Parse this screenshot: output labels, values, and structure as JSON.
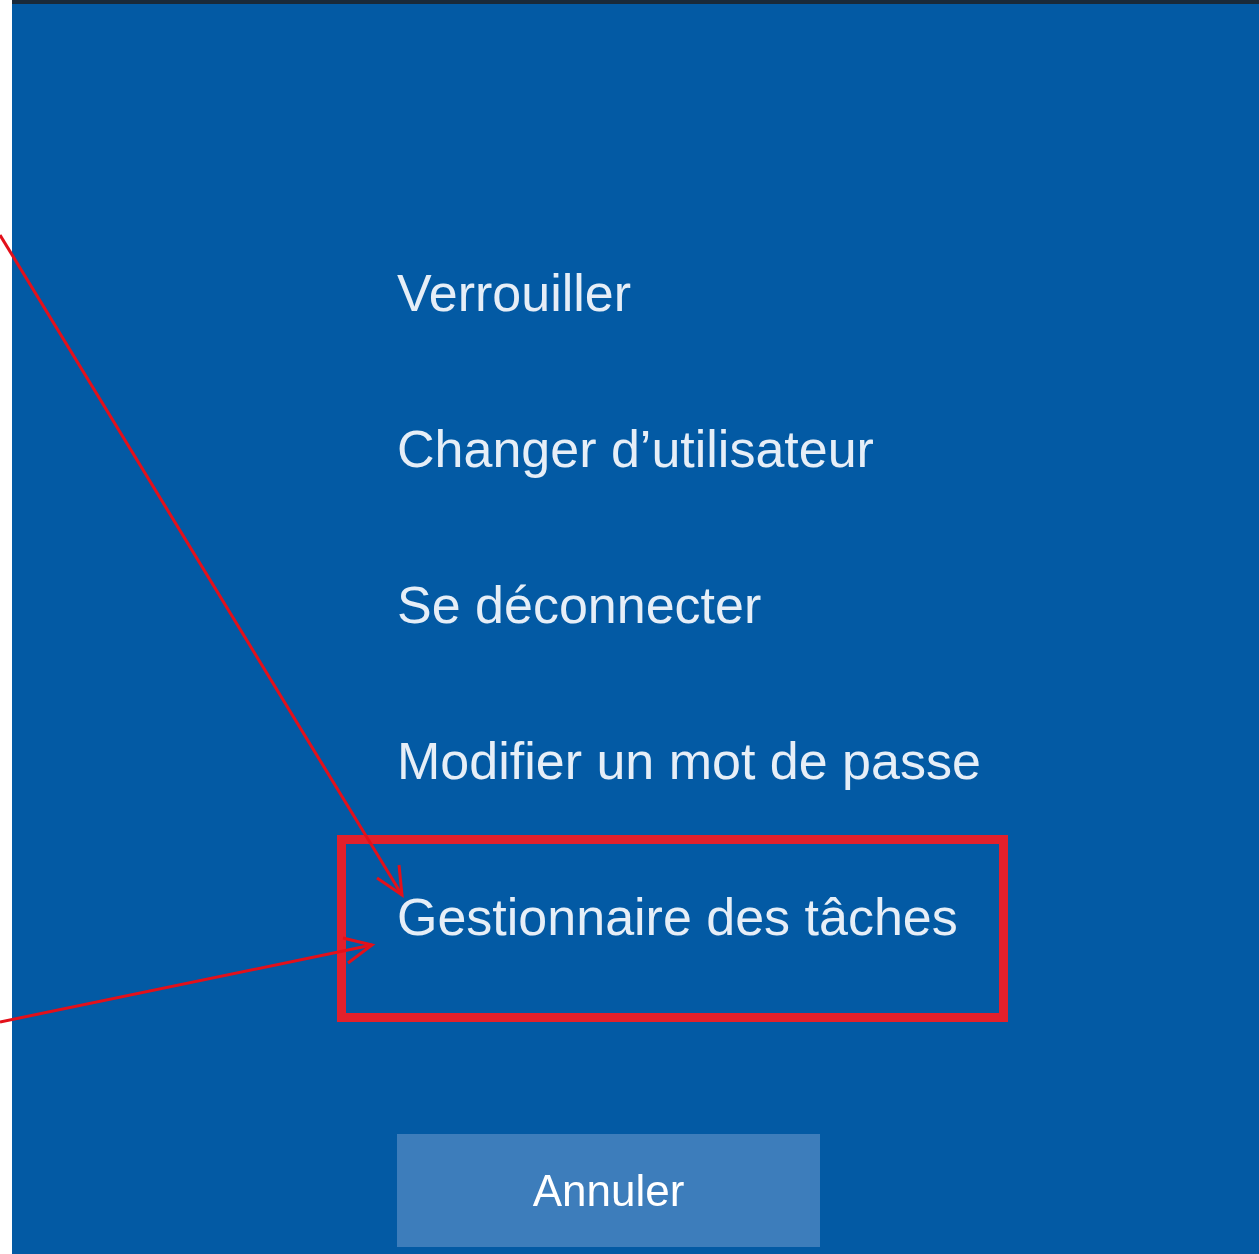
{
  "menu": [
    {
      "label": "Verrouiller",
      "highlighted": false
    },
    {
      "label": "Changer d’utilisateur",
      "highlighted": false
    },
    {
      "label": "Se déconnecter",
      "highlighted": false
    },
    {
      "label": "Modifier un mot de passe",
      "highlighted": false
    },
    {
      "label": "Gestionnaire des tâches",
      "highlighted": true
    }
  ],
  "cancel_button": "Annuler"
}
